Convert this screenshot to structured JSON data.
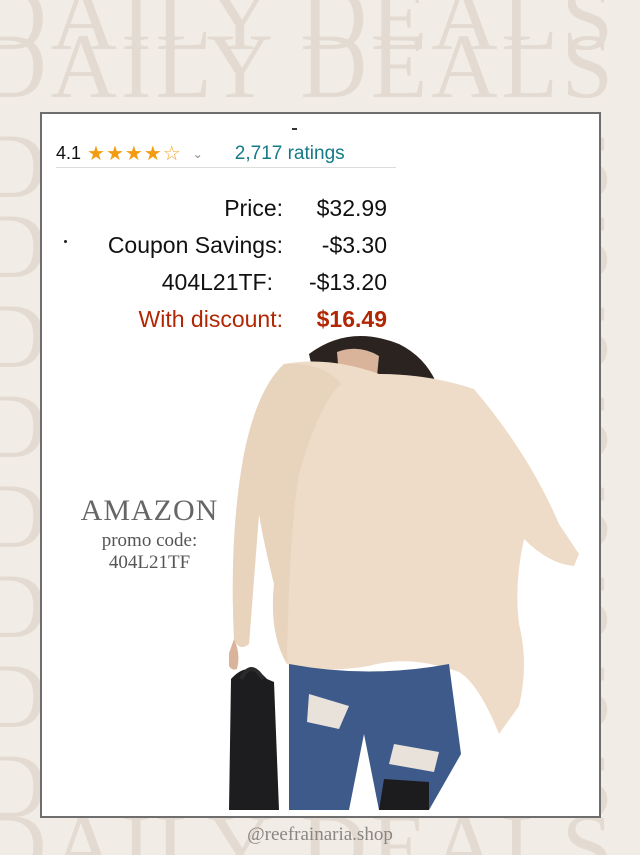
{
  "background": {
    "watermark_text": "DAILY DEALS",
    "color": "#f1ece6",
    "watermark_color": "#e3dbd1"
  },
  "rating": {
    "value": "4.1",
    "stars": 4.1,
    "chevron": "chevron-down-icon",
    "count_text": "2,717 ratings",
    "star_color": "#f39c11",
    "link_color": "#147a87"
  },
  "pricing": {
    "rows": [
      {
        "label": "Price:",
        "value": "$32.99"
      },
      {
        "label": "Coupon Savings:",
        "value": "-$3.30"
      },
      {
        "label": "404L21TF:",
        "value": "-$13.20"
      },
      {
        "label": "With discount:",
        "value": "$16.49"
      }
    ],
    "discount_color": "#b12704"
  },
  "promo": {
    "brand": "AMAZON",
    "line": "promo code:",
    "code": "404L21TF"
  },
  "footer": {
    "handle": "@reefrainaria.shop"
  }
}
